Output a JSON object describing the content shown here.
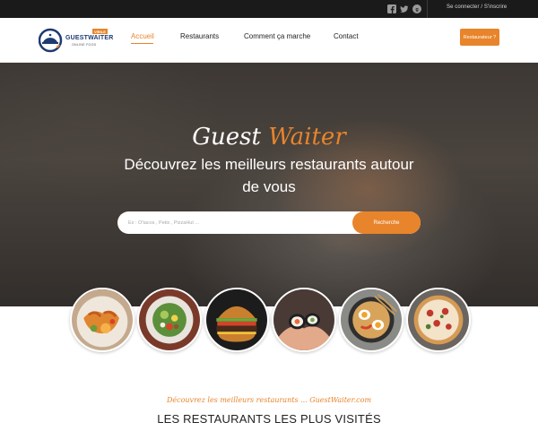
{
  "topbar": {
    "social": [
      {
        "icon": "facebook-icon"
      },
      {
        "icon": "twitter-icon"
      },
      {
        "icon": "google-plus-icon"
      }
    ],
    "login_label": "Se connecter / S'inscrire"
  },
  "brand": {
    "badge": "VIRILE",
    "name": "GUESTWAITER",
    "sub": "ONLINE FOOD",
    "script_first": "Guest",
    "script_second": "Waiter"
  },
  "nav": {
    "items": [
      {
        "label": "Accueil",
        "active": true
      },
      {
        "label": "Restaurants",
        "active": false
      },
      {
        "label": "Comment ça marche",
        "active": false
      },
      {
        "label": "Contact",
        "active": false
      }
    ],
    "cta_label": "Restaurateur ?"
  },
  "hero": {
    "title": "Découvrez les meilleurs restaurants autour de vous",
    "search_placeholder": "Ex : O'tacos , Petix , PizzaHut ...",
    "search_button": "Recherche"
  },
  "food_images": [
    {
      "icon": "seafood-plate-image"
    },
    {
      "icon": "salad-plate-image"
    },
    {
      "icon": "burger-image"
    },
    {
      "icon": "sushi-hands-image"
    },
    {
      "icon": "ramen-bowl-image"
    },
    {
      "icon": "pizza-image"
    }
  ],
  "section": {
    "tagline": "Découvrez les meilleurs restaurants ... GuestWaiter.com",
    "title": "LES RESTAURANTS LES PLUS VISITÉS"
  },
  "colors": {
    "accent": "#e8842b",
    "brand_blue": "#1d3a72",
    "topbar": "#1a1a1a"
  }
}
